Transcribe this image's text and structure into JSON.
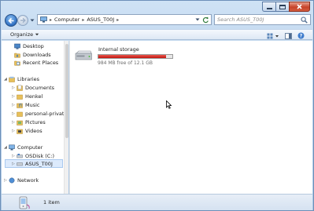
{
  "window": {
    "caption_buttons": [
      "minimize-icon",
      "maximize-icon",
      "close-icon"
    ]
  },
  "address": {
    "crumbs": [
      "Computer",
      "ASUS_T00J"
    ],
    "separator": "▸",
    "search_placeholder": "Search ASUS_T00J"
  },
  "toolbar": {
    "organize_label": "Organize",
    "icons": [
      "view-options-icon",
      "preview-pane-icon",
      "help-icon"
    ]
  },
  "sidebar": {
    "favorites": [
      "Desktop",
      "Downloads",
      "Recent Places"
    ],
    "libraries_label": "Libraries",
    "libraries": [
      "Documents",
      "Henkel",
      "Music",
      "personal-private",
      "Pictures",
      "Videos"
    ],
    "computer_label": "Computer",
    "computer": [
      "OSDisk (C:)",
      "ASUS_T00J"
    ],
    "network_label": "Network"
  },
  "content": {
    "drive": {
      "name": "Internal storage",
      "free_text": "984 MB free of 12.1 GB",
      "used_fraction": 0.92,
      "bar_color": "#d21b14"
    }
  },
  "details": {
    "item_count": "1 item"
  },
  "colors": {
    "accent": "#2f6fc1",
    "selection": "#dceafc"
  }
}
